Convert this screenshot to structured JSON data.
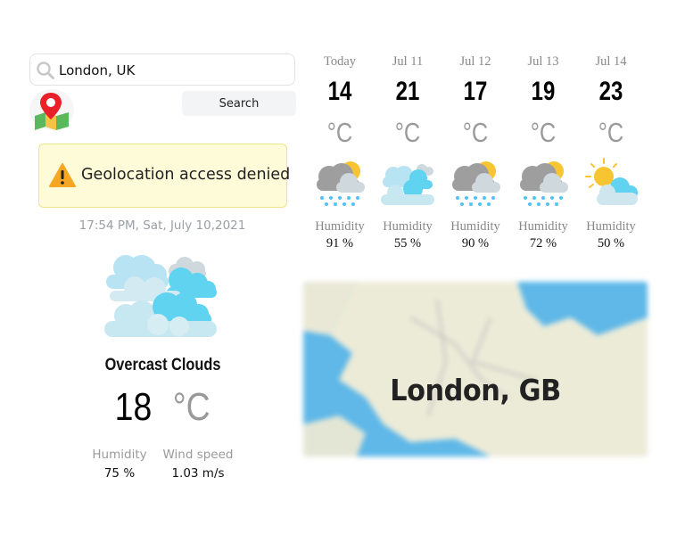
{
  "search": {
    "value": "London, UK",
    "button_label": "Search"
  },
  "alert": {
    "text": "Geolocation access denied"
  },
  "current": {
    "datetime": "17:54 PM, Sat, July 10,2021",
    "condition": "Overcast Clouds",
    "temp": "18",
    "unit": "°C",
    "humidity_label": "Humidity",
    "humidity_value": "75 %",
    "wind_label": "Wind speed",
    "wind_value": "1.03 m/s",
    "icon": "overcast-clouds-icon"
  },
  "forecast": [
    {
      "date": "Today",
      "temp": "14",
      "unit": "°C",
      "icon": "rain-cloud-sun-icon",
      "humidity_label": "Humidity",
      "humidity": "91 %"
    },
    {
      "date": "Jul 11",
      "temp": "21",
      "unit": "°C",
      "icon": "clouds-icon",
      "humidity_label": "Humidity",
      "humidity": "55 %"
    },
    {
      "date": "Jul 12",
      "temp": "17",
      "unit": "°C",
      "icon": "rain-cloud-sun-icon",
      "humidity_label": "Humidity",
      "humidity": "90 %"
    },
    {
      "date": "Jul 13",
      "temp": "19",
      "unit": "°C",
      "icon": "rain-cloud-sun-icon",
      "humidity_label": "Humidity",
      "humidity": "72 %"
    },
    {
      "date": "Jul 14",
      "temp": "23",
      "unit": "°C",
      "icon": "sun-cloud-icon",
      "humidity_label": "Humidity",
      "humidity": "50 %"
    }
  ],
  "map": {
    "label": "London, GB"
  },
  "colors": {
    "alert_bg": "#fefbd9",
    "unit_gray": "#9a9a9a",
    "cloud_blue": "#5fd3f0"
  }
}
